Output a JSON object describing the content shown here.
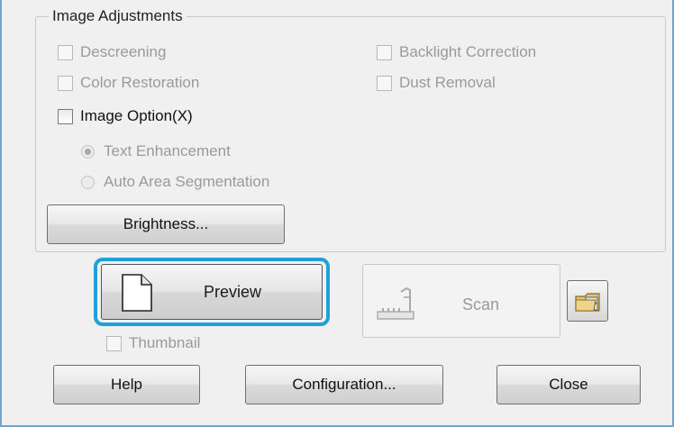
{
  "group": {
    "title": "Image Adjustments",
    "descreening": "Descreening",
    "backlight": "Backlight Correction",
    "color_restoration": "Color Restoration",
    "dust_removal": "Dust Removal",
    "image_option": "Image Option(X)",
    "text_enhancement": "Text Enhancement",
    "auto_area": "Auto Area Segmentation",
    "brightness": "Brightness..."
  },
  "actions": {
    "preview": "Preview",
    "scan": "Scan",
    "thumbnail": "Thumbnail"
  },
  "footer": {
    "help": "Help",
    "configuration": "Configuration...",
    "close": "Close"
  },
  "state": {
    "descreening_checked": false,
    "backlight_checked": false,
    "color_restoration_checked": false,
    "dust_removal_checked": false,
    "image_option_checked": false,
    "text_enhancement_selected": true,
    "thumbnail_checked": false
  },
  "colors": {
    "focus_ring": "#1ea0d8",
    "window_border": "#6fa7c9"
  }
}
